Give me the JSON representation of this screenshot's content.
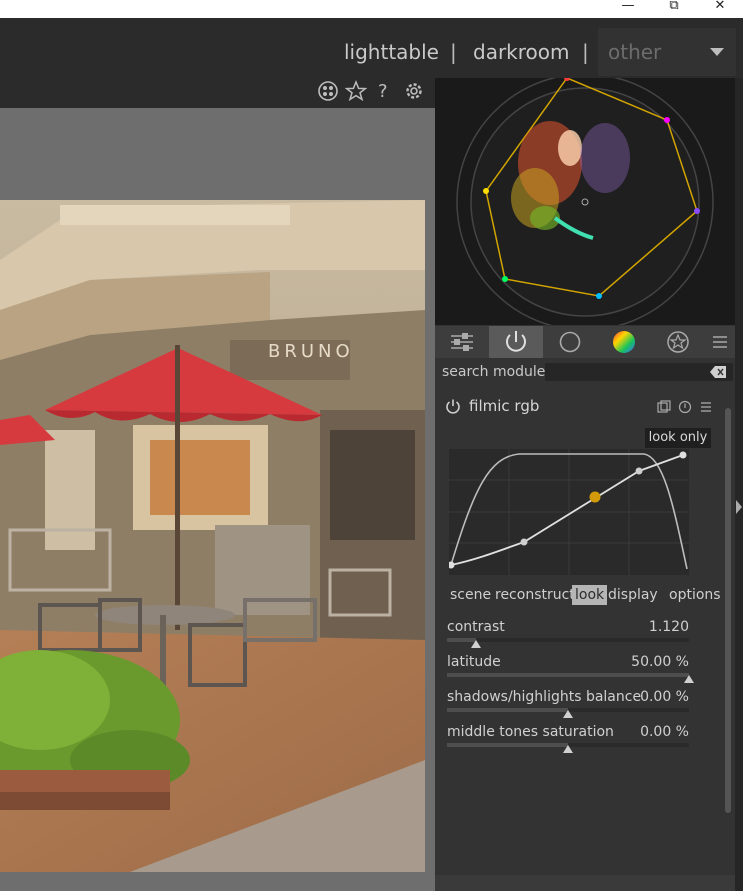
{
  "window": {
    "minimize": "—",
    "maximize": "⧉",
    "close": "✕"
  },
  "views": {
    "lighttable": "lighttable",
    "separator": "|",
    "darkroom": "darkroom",
    "other": "other"
  },
  "toolbar_icons": [
    "color-picker-icon",
    "star-icon",
    "help-icon",
    "gear-icon"
  ],
  "scope_colors": [
    "#ff3b3b",
    "#ff00ff",
    "#8a4cff",
    "#00c0ff",
    "#00ff60",
    "#ffdd00"
  ],
  "module_tabs": [
    "sliders-icon",
    "power-icon",
    "circle-icon",
    "color-wheel-icon",
    "favorites-icon",
    "menu-icon"
  ],
  "search": {
    "label": "search module",
    "placeholder": ""
  },
  "module": {
    "title": "filmic rgb",
    "look_only": "look only",
    "subtabs": [
      "scene",
      "reconstruct",
      "look",
      "display",
      "options"
    ],
    "active_subtab": "look",
    "sliders": [
      {
        "label": "contrast",
        "value": "1.120",
        "fraction": 0.12
      },
      {
        "label": "latitude",
        "value": "50.00 %",
        "fraction": 1.0
      },
      {
        "label": "shadows/highlights balance",
        "value": "0.00 %",
        "fraction": 0.5
      },
      {
        "label": "middle tones saturation",
        "value": "0.00 %",
        "fraction": 0.5
      }
    ]
  }
}
